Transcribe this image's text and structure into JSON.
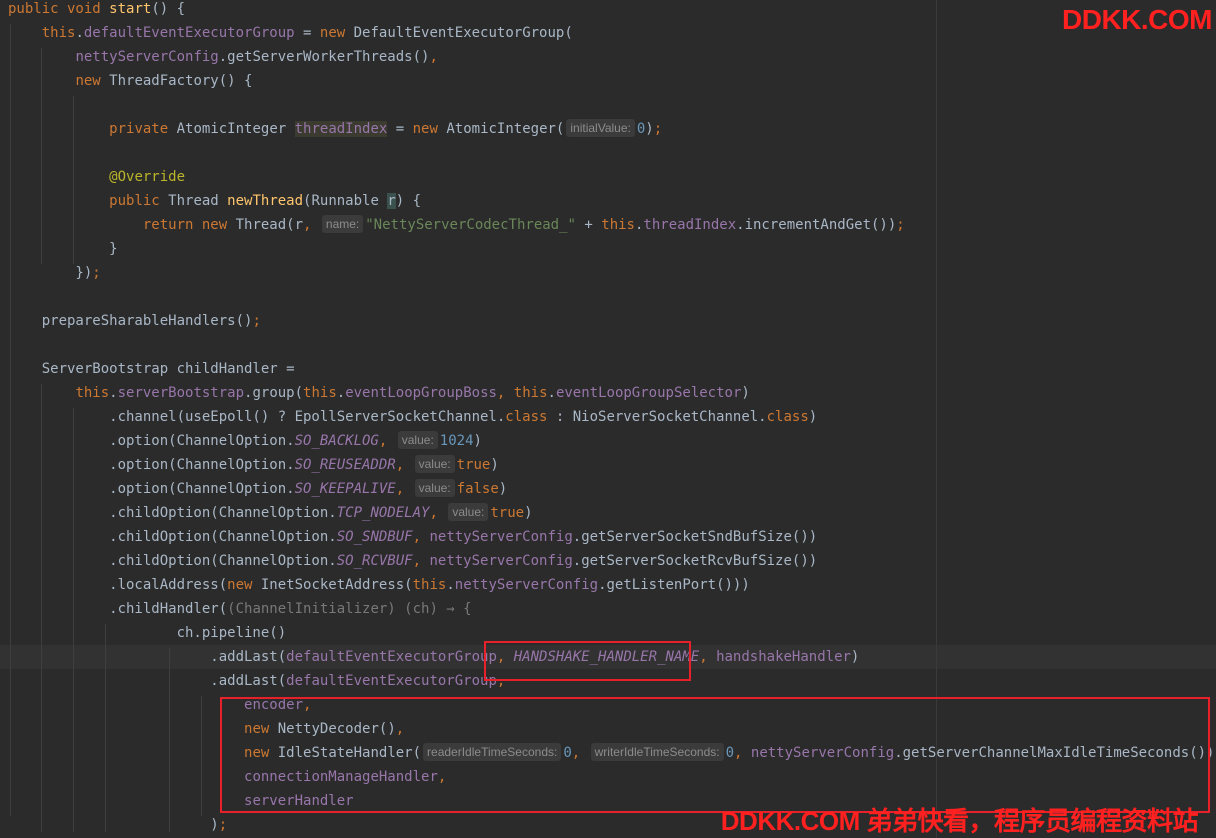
{
  "watermarks": {
    "top": "DDKK.COM",
    "bottom": "DDKK.COM 弟弟快看，程序员编程资料站"
  },
  "code": {
    "start_decl": {
      "kw": "public void",
      "name": "start",
      "rest": "() {"
    },
    "hints": {
      "initial_value": "initialValue:",
      "name": "name:",
      "value": "value:",
      "reader_idle": "readerIdleTimeSeconds:",
      "writer_idle": "writerIdleTimeSeconds:"
    },
    "strings": {
      "thread_name": "\"NettyServerCodecThread_\""
    },
    "lambda_type": "(ChannelInitializer) (ch) → {",
    "numbers": {
      "zero": "0",
      "backlog": "1024"
    },
    "booleans": {
      "t": "true",
      "f": "false"
    },
    "annotation": "@Override",
    "constants": {
      "so_backlog": "SO_BACKLOG",
      "so_reuseaddr": "SO_REUSEADDR",
      "so_keepalive": "SO_KEEPALIVE",
      "tcp_nodelay": "TCP_NODELAY",
      "so_sndbuf": "SO_SNDBUF",
      "so_rcvbuf": "SO_RCVBUF",
      "handshake_name": "HANDSHAKE_HANDLER_NAME"
    }
  }
}
